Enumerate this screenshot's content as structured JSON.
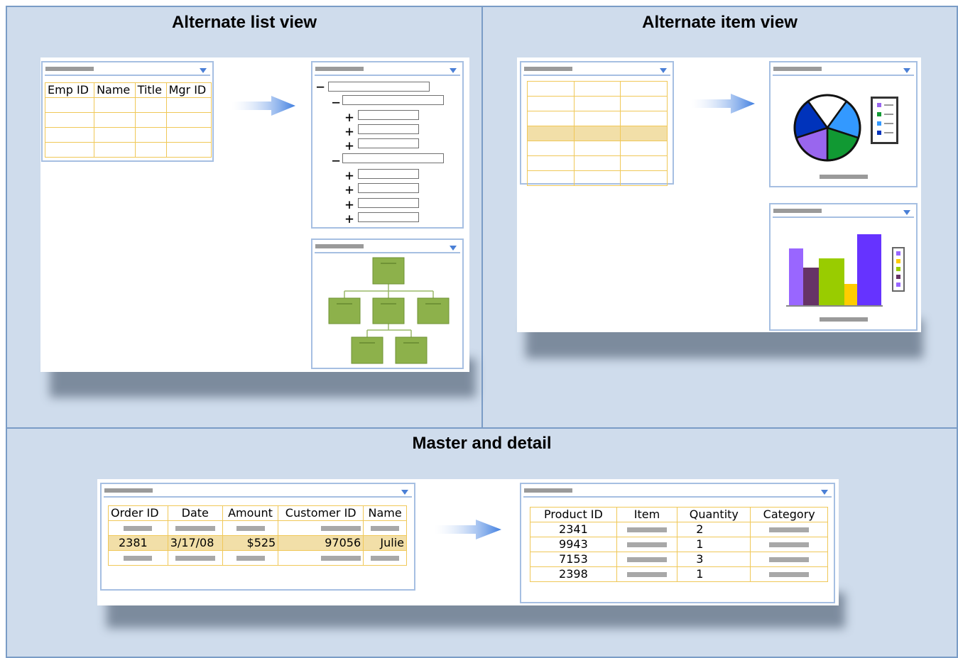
{
  "sections": {
    "list_view_title": "Alternate list view",
    "item_view_title": "Alternate item view",
    "master_detail_title": "Master and detail"
  },
  "list_view": {
    "employee_table": {
      "headers": [
        "Emp ID",
        "Name",
        "Title",
        "Mgr ID"
      ]
    }
  },
  "master_detail": {
    "orders_table": {
      "headers": [
        "Order ID",
        "Date",
        "Amount",
        "Customer ID",
        "Name"
      ],
      "selected_row": [
        "2381",
        "3/17/08",
        "$525",
        "97056",
        "Julie"
      ]
    },
    "products_table": {
      "headers": [
        "Product ID",
        "Item",
        "Quantity",
        "Category"
      ],
      "rows": [
        {
          "product_id": "2341",
          "quantity": "2"
        },
        {
          "product_id": "9943",
          "quantity": "1"
        },
        {
          "product_id": "7153",
          "quantity": "3"
        },
        {
          "product_id": "2398",
          "quantity": "1"
        }
      ]
    }
  },
  "colors": {
    "cell_bg": "#cfdcec",
    "cell_border": "#7a9cc6",
    "panel_border": "#a6bfe2",
    "table_border": "#f0c858",
    "selected_row": "#f2dfa8",
    "org_box": "#8db14b",
    "pie_slices": [
      "#ffffff",
      "#3399ff",
      "#119933",
      "#9966ee",
      "#0033bb"
    ],
    "bar_colors": [
      "#9966ff",
      "#663366",
      "#99cc00",
      "#ffcc00",
      "#6633ff"
    ]
  },
  "pie_chart": {
    "slices": [
      20,
      20,
      20,
      20,
      20
    ]
  },
  "bar_chart": {
    "values": [
      80,
      53,
      66,
      30,
      100
    ],
    "ylim": [
      0,
      100
    ]
  }
}
